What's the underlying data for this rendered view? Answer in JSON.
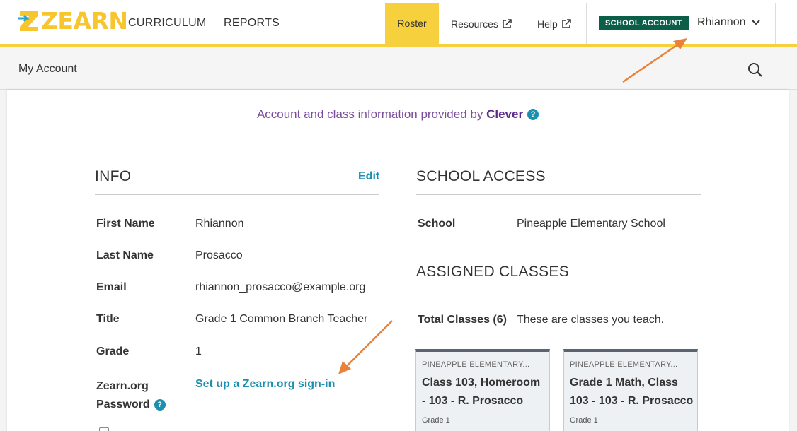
{
  "app": {
    "logo_text": "ZEARN",
    "nav_main": [
      "CURRICULUM",
      "REPORTS"
    ],
    "nav_roster": "Roster",
    "nav_resources": "Resources",
    "nav_help": "Help",
    "account_badge": "SCHOOL ACCOUNT",
    "user_name": "Rhiannon",
    "page_title": "My Account"
  },
  "banner": {
    "prefix": "Account and class information provided by",
    "brand": "Clever"
  },
  "info": {
    "title": "INFO",
    "edit_label": "Edit",
    "rows": [
      {
        "label": "First Name",
        "value": "Rhiannon"
      },
      {
        "label": "Last Name",
        "value": "Prosacco"
      },
      {
        "label": "Email",
        "value": "rhiannon_prosacco@example.org"
      },
      {
        "label": "Title",
        "value": "Grade 1 Common Branch Teacher"
      },
      {
        "label": "Grade",
        "value": "1"
      }
    ],
    "password_label_1": "Zearn.org",
    "password_label_2": "Password",
    "password_link": "Set up a Zearn.org sign-in"
  },
  "school_access": {
    "title": "SCHOOL ACCESS",
    "school_label": "School",
    "school_value": "Pineapple Elementary School"
  },
  "assigned": {
    "title": "ASSIGNED CLASSES",
    "total_label": "Total Classes (6)",
    "total_note": "These are classes you teach.",
    "classes": [
      {
        "school": "PINEAPPLE ELEMENTARY...",
        "name": "Class 103, Homeroom - 103 - R. Prosacco",
        "grade": "Grade 1"
      },
      {
        "school": "PINEAPPLE ELEMENTARY...",
        "name": "Grade 1 Math, Class 103 - 103 - R. Prosacco",
        "grade": "Grade 1"
      }
    ]
  },
  "icons": {
    "search": "search-icon",
    "external": "external-link-icon",
    "chevron": "chevron-down-icon",
    "help": "help-circle-icon"
  },
  "colors": {
    "accent_yellow": "#f7d13d",
    "link_blue": "#1b8fb0",
    "badge_green": "#0b5e48",
    "clever_purple": "#5b2a8a",
    "annotation_orange": "#e8813a"
  }
}
